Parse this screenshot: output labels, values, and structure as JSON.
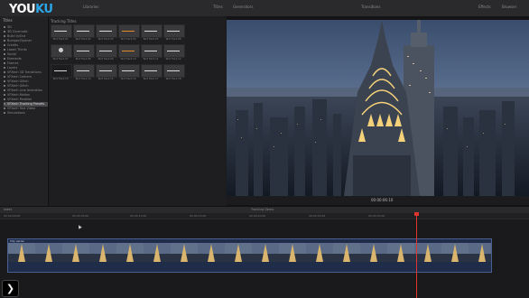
{
  "topbar": {
    "logo_a": "YOU",
    "logo_b": "KU",
    "items": [
      "Libraries",
      "Titles",
      "Generators",
      "Transitions",
      "Effects",
      "Browser"
    ]
  },
  "sidebar": {
    "head": "Titles",
    "items": [
      {
        "label": "3D",
        "sel": false
      },
      {
        "label": "3D Cinematic",
        "sel": false
      },
      {
        "label": "Build In/Out",
        "sel": false
      },
      {
        "label": "Bumper/Opener",
        "sel": false
      },
      {
        "label": "Credits",
        "sel": false
      },
      {
        "label": "Lower Thirds",
        "sel": false
      },
      {
        "label": "Social",
        "sel": false
      },
      {
        "label": "Elements",
        "sel": false
      },
      {
        "label": "Frames",
        "sel": false
      },
      {
        "label": "Layers",
        "sel": false
      },
      {
        "label": "VFXech 3D Transitions",
        "sel": false
      },
      {
        "label": "VFXech Camera",
        "sel": false
      },
      {
        "label": "VFXech Glitch",
        "sel": false
      },
      {
        "label": "VFXech Glitch",
        "sel": false
      },
      {
        "label": "VFXech Line Animation",
        "sel": false
      },
      {
        "label": "VFXech Motion",
        "sel": false
      },
      {
        "label": "VFXech Parallax",
        "sel": false
      },
      {
        "label": "VFXech Tracking Presets",
        "sel": true
      },
      {
        "label": "VFXech Text Video",
        "sel": false
      },
      {
        "label": "Simulations",
        "sel": false
      }
    ]
  },
  "browser": {
    "title": "Tracking Titles",
    "thumbs": [
      {
        "label": "Text Track 01",
        "style": "plain"
      },
      {
        "label": "Text Track 02",
        "style": "plain"
      },
      {
        "label": "Text Track 03",
        "style": "plain"
      },
      {
        "label": "Text Track 04",
        "style": "orange"
      },
      {
        "label": "Text Track 05",
        "style": "plain"
      },
      {
        "label": "Text Track 06",
        "style": "plain"
      },
      {
        "label": "Text Track 07",
        "style": "circle"
      },
      {
        "label": "Text Track 08",
        "style": "plain"
      },
      {
        "label": "Text Track 09",
        "style": "plain"
      },
      {
        "label": "Text Track 10",
        "style": "orange"
      },
      {
        "label": "Text Track 11",
        "style": "plain"
      },
      {
        "label": "Text Track 12",
        "style": "plain"
      },
      {
        "label": "Text Track 13",
        "style": "dark"
      },
      {
        "label": "Text Track 14",
        "style": "plain"
      },
      {
        "label": "Text Track 15",
        "style": "plain"
      },
      {
        "label": "Text Track 16",
        "style": "plain"
      },
      {
        "label": "Text Track 17",
        "style": "plain"
      },
      {
        "label": "Text Track 18",
        "style": "plain"
      }
    ]
  },
  "viewer": {
    "title": "Tracking Demo",
    "timecode": "00:00:06:10"
  },
  "toolbar2": {
    "items": [
      "Index",
      "Tracking Demo"
    ]
  },
  "timeline": {
    "ruler": [
      "00:00:00:00",
      "00:00:05:00",
      "00:00:10:00",
      "00:00:15:00",
      "00:00:20:00",
      "00:00:25:00",
      "00:00:30:00"
    ],
    "clip_name": "City Aerial"
  },
  "skip_button": "❯"
}
